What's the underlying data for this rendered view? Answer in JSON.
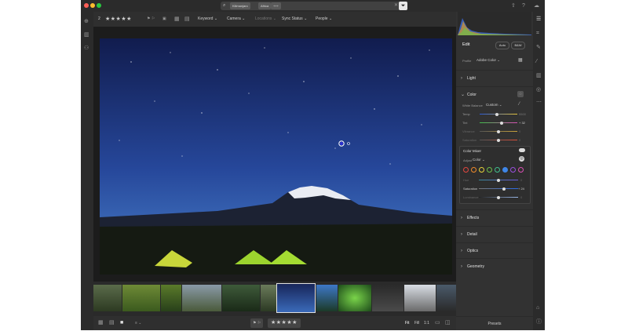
{
  "search": {
    "tokens": [
      "Kilimanjaro",
      "Africa",
      "+++"
    ]
  },
  "toolbar": {
    "count": "2",
    "stars": "★★★★★",
    "filters": [
      "Keyword",
      "Camera",
      "Locations",
      "Sync Status",
      "People"
    ]
  },
  "photo_edit_strip": {
    "tabs": [
      "Hue",
      "Saturation",
      "Luminance"
    ],
    "active": "Saturation"
  },
  "bottombar": {
    "stars": "★★★★★",
    "fit": "Fit",
    "fill": "Fill",
    "ratio": "1:1",
    "presets": "Presets"
  },
  "edit_panel": {
    "title": "Edit",
    "auto": "Auto",
    "bw": "B&W",
    "profile_label": "Profile",
    "profile_value": "Adobe Color",
    "sections": [
      "Light",
      "Color",
      "Effects",
      "Detail",
      "Optics",
      "Geometry"
    ],
    "color": {
      "white_balance_label": "White Balance",
      "white_balance_value": "Custom",
      "sliders": [
        {
          "label": "Temp",
          "value": "5500"
        },
        {
          "label": "Tint",
          "value": "+ 32"
        },
        {
          "label": "Vibrance",
          "value": "0"
        },
        {
          "label": "Saturation",
          "value": "0"
        }
      ]
    },
    "mixer": {
      "title": "Color Mixer",
      "adjust_label": "Adjust",
      "adjust_value": "Color",
      "sliders": [
        {
          "label": "Hue",
          "value": "0"
        },
        {
          "label": "Saturation",
          "value": "+ 24"
        },
        {
          "label": "Luminance",
          "value": "0"
        }
      ],
      "swatches": [
        "#e2473f",
        "#f08a2a",
        "#e6d23a",
        "#6cc04a",
        "#3fbf8e",
        "#3f86e8",
        "#9a4fe0",
        "#d94fb5"
      ],
      "selected_swatch": 5
    }
  },
  "colors": {
    "accent": "#2b7dd8",
    "window_bg": "#323232",
    "sky_top": "#15225a",
    "sky_bottom": "#3a6dbb"
  }
}
